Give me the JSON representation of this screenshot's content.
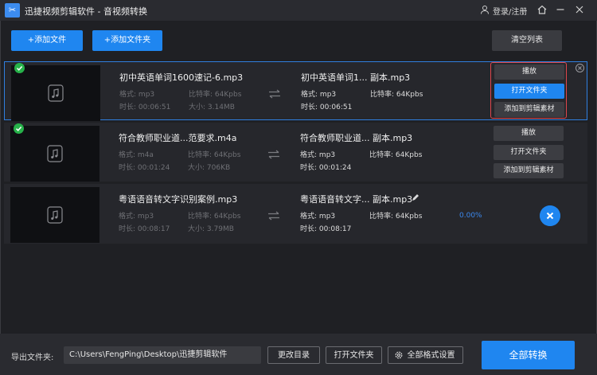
{
  "titlebar": {
    "title": "迅捷视频剪辑软件 - 音视频转换",
    "login": "登录/注册",
    "icons": [
      "user-icon",
      "home-icon",
      "minimize-icon",
      "close-icon"
    ]
  },
  "toolbar": {
    "add_file": "+添加文件",
    "add_folder": "+添加文件夹",
    "clear_list": "清空列表"
  },
  "labels": {
    "format": "格式:",
    "bitrate": "比特率:",
    "duration": "时长:",
    "size": "大小:"
  },
  "actions": {
    "play": "播放",
    "open_folder": "打开文件夹",
    "add_to_material": "添加到剪辑素材"
  },
  "files": [
    {
      "src_name": "初中英语单词1600速记-6.mp3",
      "src_format": "mp3",
      "src_bitrate": "64Kpbs",
      "src_duration": "00:06:51",
      "src_size": "3.14MB",
      "dst_name": "初中英语单词1... 副本.mp3",
      "dst_format": "mp3",
      "dst_bitrate": "64Kpbs",
      "dst_duration": "00:06:51",
      "status": "done"
    },
    {
      "src_name": "符合教师职业道...范要求.m4a",
      "src_format": "m4a",
      "src_bitrate": "64Kpbs",
      "src_duration": "00:01:24",
      "src_size": "706KB",
      "dst_name": "符合教师职业道... 副本.mp3",
      "dst_format": "mp3",
      "dst_bitrate": "64Kpbs",
      "dst_duration": "00:01:24",
      "status": "done"
    },
    {
      "src_name": "粤语语音转文字识别案例.mp3",
      "src_format": "mp3",
      "src_bitrate": "64Kpbs",
      "src_duration": "00:08:17",
      "src_size": "3.79MB",
      "dst_name": "粤语语音转文字... 副本.mp3",
      "dst_format": "mp3",
      "dst_bitrate": "64Kpbs",
      "dst_duration": "00:08:17",
      "progress": "0.00%",
      "status": "pending"
    }
  ],
  "bottom": {
    "export_label": "导出文件夹:",
    "path": "C:\\Users\\FengPing\\Desktop\\迅捷剪辑软件",
    "change_dir": "更改目录",
    "open_folder": "打开文件夹",
    "format_settings": "全部格式设置",
    "convert_all": "全部转换"
  },
  "colors": {
    "accent": "#1f86f0",
    "success": "#27b24a",
    "highlight": "#e0474c",
    "background": "#1f2024"
  }
}
